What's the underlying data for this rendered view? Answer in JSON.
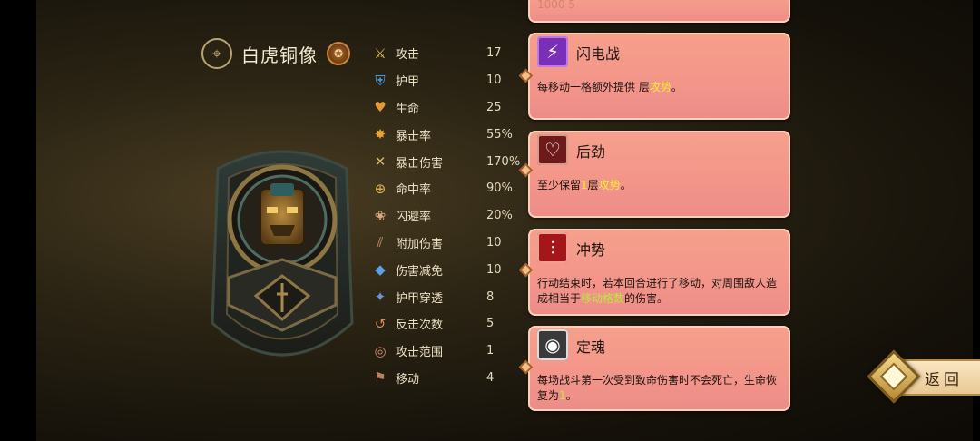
{
  "unit": {
    "name": "白虎铜像",
    "class_icon": "compass-icon",
    "rank_icon": "rank-badge-icon"
  },
  "stats": [
    {
      "label": "攻击",
      "value": "17",
      "icon": "attack-icon",
      "color": "#e4c44a",
      "glyph": "⚔"
    },
    {
      "label": "护甲",
      "value": "10",
      "icon": "armor-icon",
      "color": "#4b9bd6",
      "glyph": "⛨"
    },
    {
      "label": "生命",
      "value": "25",
      "icon": "heart-icon",
      "color": "#e09a3a",
      "glyph": "♥"
    },
    {
      "label": "暴击率",
      "value": "55%",
      "icon": "crit-rate-icon",
      "color": "#e8a436",
      "glyph": "✸"
    },
    {
      "label": "暴击伤害",
      "value": "170%",
      "icon": "crit-damage-icon",
      "color": "#d9b86a",
      "glyph": "✕"
    },
    {
      "label": "命中率",
      "value": "90%",
      "icon": "accuracy-icon",
      "color": "#e0b44c",
      "glyph": "⊕"
    },
    {
      "label": "闪避率",
      "value": "20%",
      "icon": "dodge-icon",
      "color": "#d8a982",
      "glyph": "❀"
    },
    {
      "label": "附加伤害",
      "value": "10",
      "icon": "bonus-damage-icon",
      "color": "#c9986a",
      "glyph": "⫽"
    },
    {
      "label": "伤害减免",
      "value": "10",
      "icon": "damage-reduction-icon",
      "color": "#5ea0e8",
      "glyph": "◆"
    },
    {
      "label": "护甲穿透",
      "value": "8",
      "icon": "armor-pierce-icon",
      "color": "#6f8fd8",
      "glyph": "✦"
    },
    {
      "label": "反击次数",
      "value": "5",
      "icon": "counter-icon",
      "color": "#d48a63",
      "glyph": "↺"
    },
    {
      "label": "攻击范围",
      "value": "1",
      "icon": "range-icon",
      "color": "#c88e6e",
      "glyph": "◎"
    },
    {
      "label": "移动",
      "value": "4",
      "icon": "move-icon",
      "color": "#b88062",
      "glyph": "⚑"
    }
  ],
  "skills_top_faded": "1000    5",
  "skills": [
    {
      "name": "闪电战",
      "icon": "lightning-icon",
      "glyph": "⚡",
      "icon_bg": "#7a2fb8",
      "desc_a": "每移动一格额外提供",
      "desc_hl_b": "",
      "desc_c": "层",
      "desc_hl_d": "攻势",
      "desc_e": "。"
    },
    {
      "name": "后劲",
      "icon": "aftershock-icon",
      "glyph": "♡",
      "icon_bg": "#6e1a1a",
      "desc_a": "至少保留",
      "desc_hl_b": "1",
      "desc_c": "层",
      "desc_hl_d": "攻势",
      "desc_e": "。"
    },
    {
      "name": "冲势",
      "icon": "momentum-icon",
      "glyph": "⫶",
      "icon_bg": "#a3161a",
      "desc_a": "行动结束时，若本回合进行了移动，对周围敌人造成相当于",
      "desc_hl_b": "移动格数",
      "desc_c": "的伤害。",
      "desc_hl_d": "",
      "desc_e": ""
    },
    {
      "name": "定魂",
      "icon": "soul-anchor-icon",
      "glyph": "◉",
      "icon_bg": "#3a3a3a",
      "desc_a": "每场战斗第一次受到致命伤害时不会死亡，生命恢复为",
      "desc_hl_b": "1",
      "desc_c": "。",
      "desc_hl_d": "",
      "desc_e": ""
    }
  ],
  "back_button": {
    "label": "返回",
    "icon": "back-emblem-icon"
  },
  "colors": {
    "card_bg": "#f3958a",
    "highlight_yellow": "#f7ea35",
    "highlight_green": "#b8ec3a"
  }
}
